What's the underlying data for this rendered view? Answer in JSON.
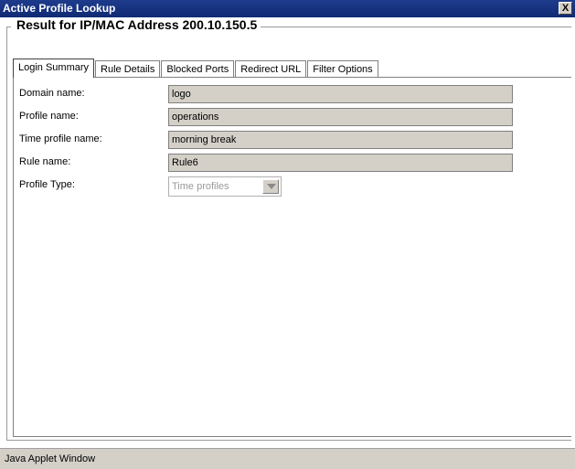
{
  "window": {
    "title": "Active Profile Lookup",
    "close_glyph": "X"
  },
  "group": {
    "title": "Result for IP/MAC Address 200.10.150.5"
  },
  "tabs": [
    {
      "label": "Login Summary",
      "active": true
    },
    {
      "label": "Rule Details",
      "active": false
    },
    {
      "label": "Blocked Ports",
      "active": false
    },
    {
      "label": "Redirect URL",
      "active": false
    },
    {
      "label": "Filter Options",
      "active": false
    }
  ],
  "fields": {
    "domain": {
      "label": "Domain name:",
      "value": "logo"
    },
    "profile": {
      "label": "Profile name:",
      "value": "operations"
    },
    "time_profile": {
      "label": "Time profile name:",
      "value": "morning break"
    },
    "rule": {
      "label": "Rule name:",
      "value": "Rule6"
    },
    "profile_type": {
      "label": "Profile Type:",
      "value": "Time profiles"
    }
  },
  "status": {
    "text": "Java Applet Window"
  },
  "colors": {
    "titlebar": "#1e3c8c",
    "field_bg": "#d4d0c8",
    "disabled_text": "#9a9a9a"
  }
}
